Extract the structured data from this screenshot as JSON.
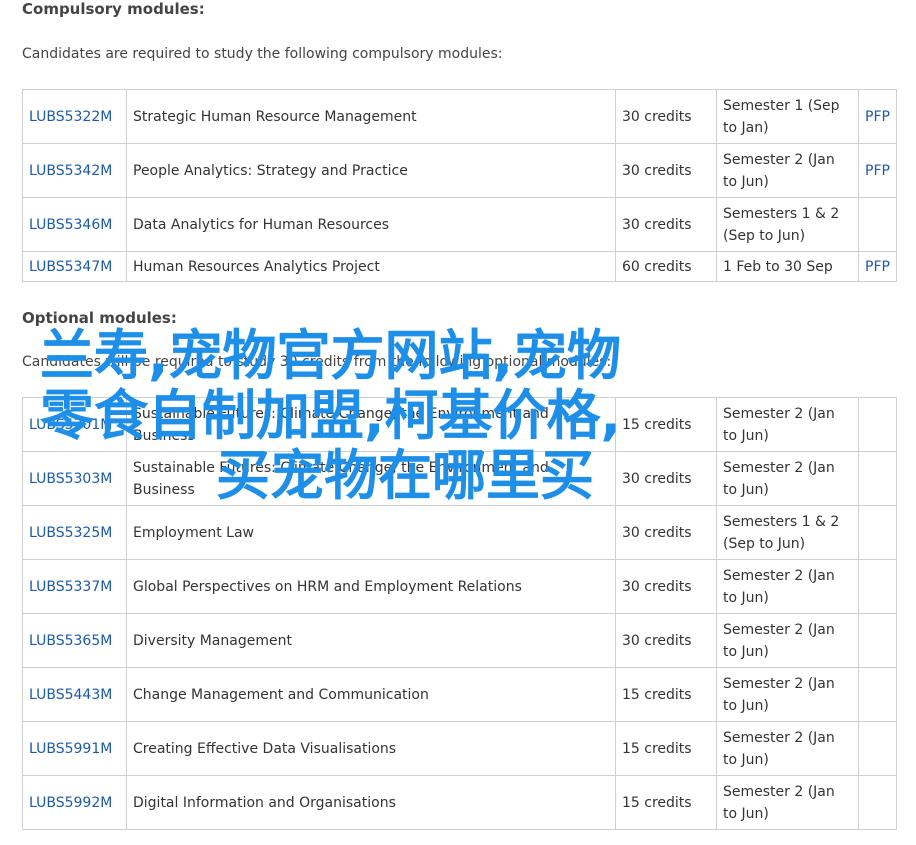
{
  "compulsory": {
    "heading": "Compulsory modules:",
    "intro": "Candidates are required to study the following compulsory modules:",
    "rows": [
      {
        "code": "LUBS5322M",
        "title": "Strategic Human Resource Management",
        "credits": "30 credits",
        "semester": "Semester 1 (Sep to Jan)",
        "spec": "PFP"
      },
      {
        "code": "LUBS5342M",
        "title": "People Analytics: Strategy and Practice",
        "credits": "30 credits",
        "semester": "Semester 2 (Jan to Jun)",
        "spec": "PFP"
      },
      {
        "code": "LUBS5346M",
        "title": "Data Analytics for Human Resources",
        "credits": "30 credits",
        "semester": "Semesters 1 & 2 (Sep to Jun)",
        "spec": ""
      },
      {
        "code": "LUBS5347M",
        "title": "Human Resources Analytics Project",
        "credits": "60 credits",
        "semester": "1 Feb to 30 Sep",
        "spec": "PFP"
      }
    ]
  },
  "optional": {
    "heading": "Optional modules:",
    "intro": "Candidates will be required to study 30 credits from the following optional modules:",
    "rows": [
      {
        "code": "LUBS5301M",
        "title": "Sustainable Futures: Climate Change, the Environment and Business",
        "credits": "15 credits",
        "semester": "Semester 2 (Jan to Jun)",
        "spec": ""
      },
      {
        "code": "LUBS5303M",
        "title": "Sustainable Futures: Climate Change, the Environment and Business",
        "credits": "30 credits",
        "semester": "Semester 2 (Jan to Jun)",
        "spec": ""
      },
      {
        "code": "LUBS5325M",
        "title": "Employment Law",
        "credits": "30 credits",
        "semester": "Semesters 1 & 2 (Sep to Jun)",
        "spec": ""
      },
      {
        "code": "LUBS5337M",
        "title": "Global Perspectives on HRM and Employment Relations",
        "credits": "30 credits",
        "semester": "Semester 2 (Jan to Jun)",
        "spec": ""
      },
      {
        "code": "LUBS5365M",
        "title": "Diversity Management",
        "credits": "30 credits",
        "semester": "Semester 2 (Jan to Jun)",
        "spec": ""
      },
      {
        "code": "LUBS5443M",
        "title": "Change Management and Communication",
        "credits": "15 credits",
        "semester": "Semester 2 (Jan to Jun)",
        "spec": ""
      },
      {
        "code": "LUBS5991M",
        "title": "Creating Effective Data Visualisations",
        "credits": "15 credits",
        "semester": "Semester 2 (Jan to Jun)",
        "spec": ""
      },
      {
        "code": "LUBS5992M",
        "title": "Digital Information and Organisations",
        "credits": "15 credits",
        "semester": "Semester 2 (Jan to Jun)",
        "spec": ""
      }
    ]
  },
  "overlay": {
    "line1": "兰寿,宠物官方网站,宠物",
    "line2": "零食自制加盟,柯基价格,",
    "line3": "买宠物在哪里买"
  },
  "colors": {
    "link": "#1e5aa8",
    "overlay": "#1e8fe8",
    "border": "#cfcfcf"
  }
}
